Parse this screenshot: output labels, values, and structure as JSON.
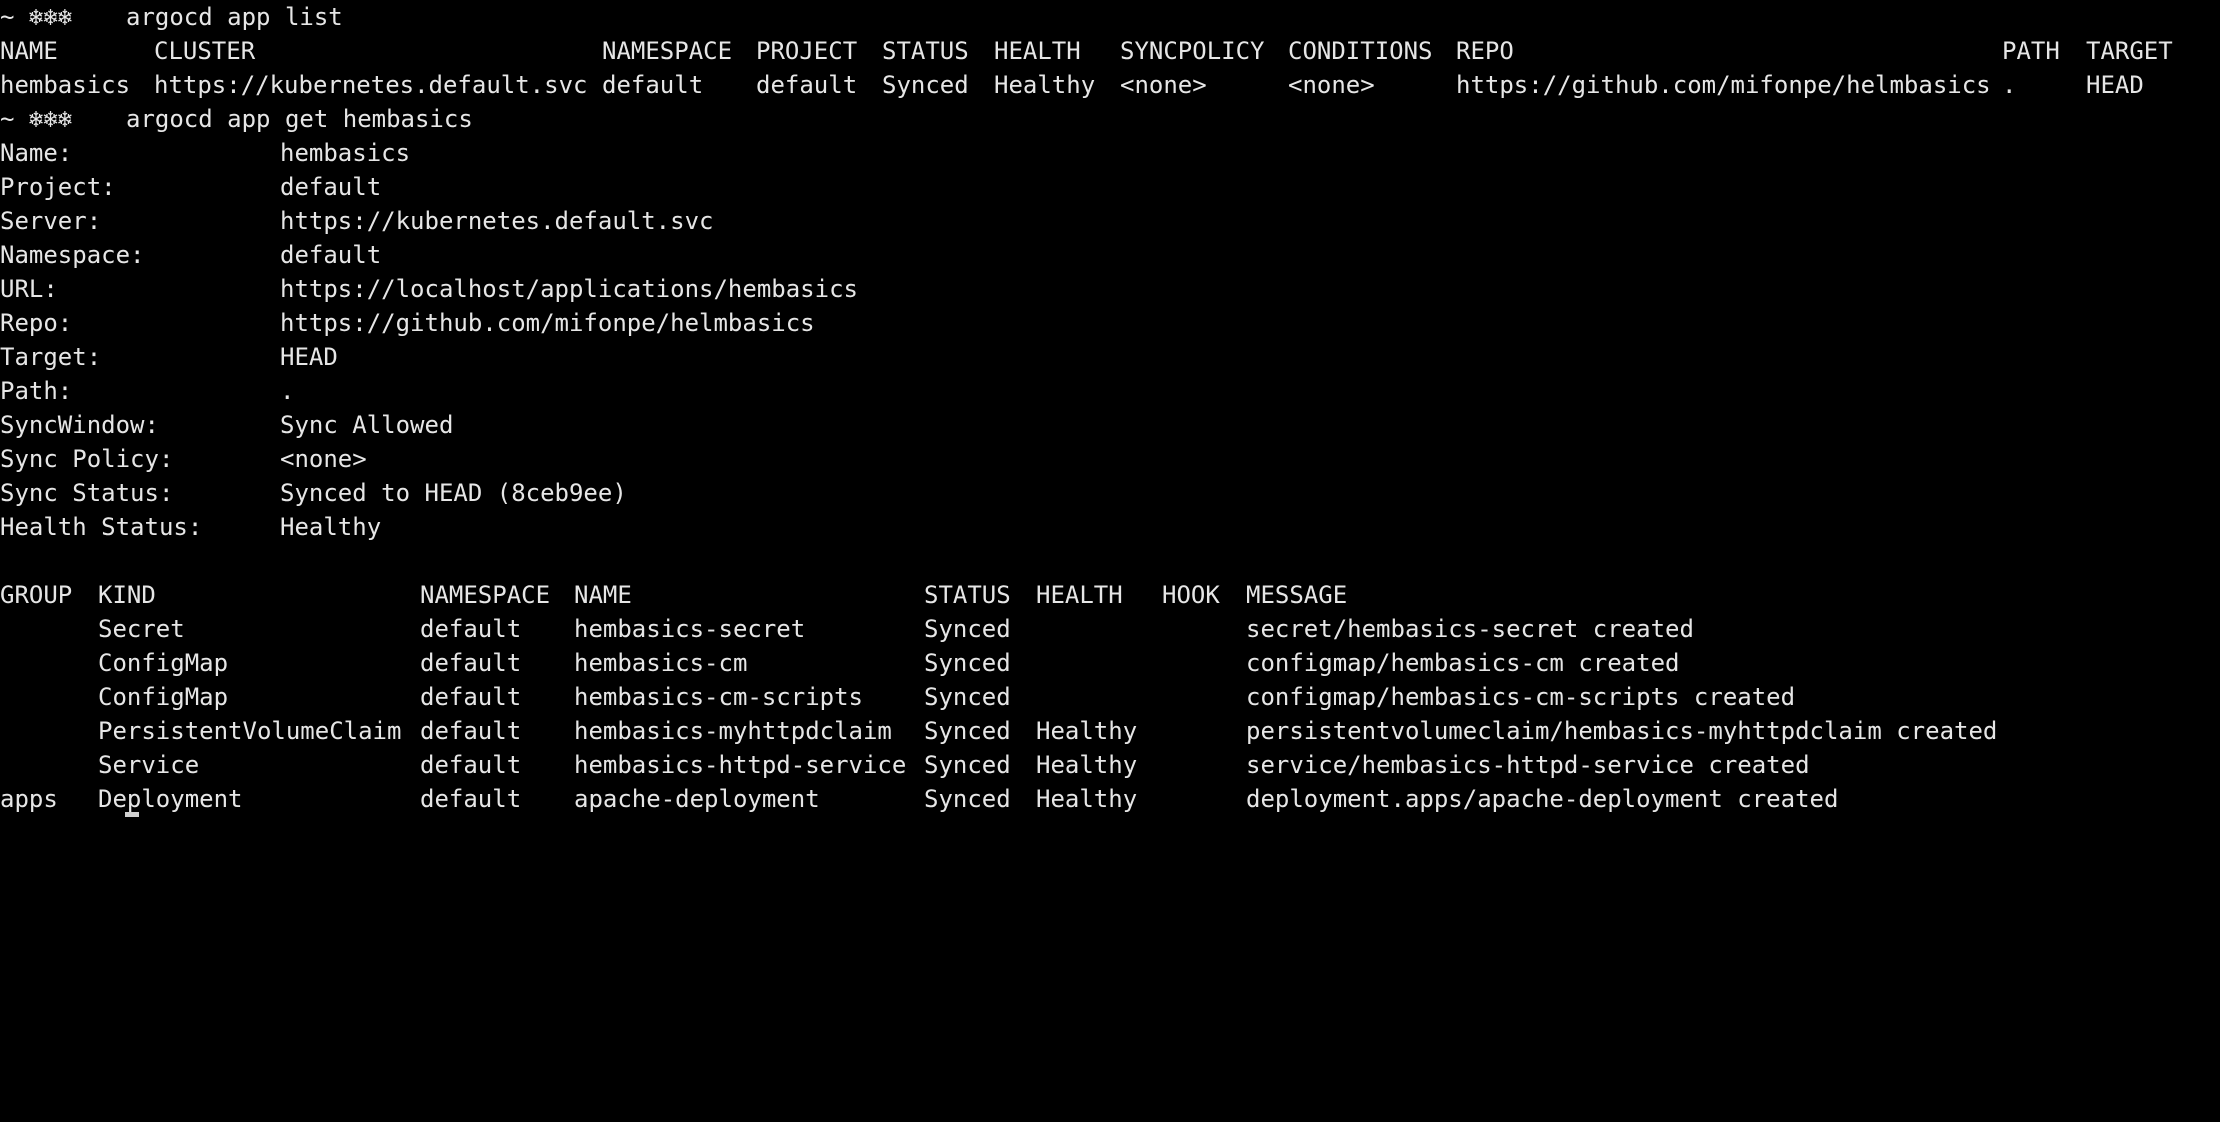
{
  "prompt": {
    "symbol": "~ ❄❄❄"
  },
  "commands": {
    "list": "argocd app list",
    "get": "argocd app get hembasics"
  },
  "app_list": {
    "headers": [
      "NAME",
      "CLUSTER",
      "NAMESPACE",
      "PROJECT",
      "STATUS",
      "HEALTH",
      "SYNCPOLICY",
      "CONDITIONS",
      "REPO",
      "PATH",
      "TARGET"
    ],
    "rows": [
      [
        "hembasics",
        "https://kubernetes.default.svc",
        "default",
        "default",
        "Synced",
        "Healthy",
        "<none>",
        "<none>",
        "https://github.com/mifonpe/helmbasics",
        ".",
        "HEAD"
      ]
    ]
  },
  "app_details": [
    {
      "label": "Name:",
      "value": "hembasics"
    },
    {
      "label": "Project:",
      "value": "default"
    },
    {
      "label": "Server:",
      "value": "https://kubernetes.default.svc"
    },
    {
      "label": "Namespace:",
      "value": "default"
    },
    {
      "label": "URL:",
      "value": "https://localhost/applications/hembasics"
    },
    {
      "label": "Repo:",
      "value": "https://github.com/mifonpe/helmbasics"
    },
    {
      "label": "Target:",
      "value": "HEAD"
    },
    {
      "label": "Path:",
      "value": "."
    },
    {
      "label": "SyncWindow:",
      "value": "Sync Allowed"
    },
    {
      "label": "Sync Policy:",
      "value": "<none>"
    },
    {
      "label": "Sync Status:",
      "value": "Synced to HEAD (8ceb9ee)"
    },
    {
      "label": "Health Status:",
      "value": "Healthy"
    }
  ],
  "resources": {
    "headers": [
      "GROUP",
      "KIND",
      "NAMESPACE",
      "NAME",
      "STATUS",
      "HEALTH",
      "HOOK",
      "MESSAGE"
    ],
    "rows": [
      [
        "",
        "Secret",
        "default",
        "hembasics-secret",
        "Synced",
        "",
        "",
        "secret/hembasics-secret created"
      ],
      [
        "",
        "ConfigMap",
        "default",
        "hembasics-cm",
        "Synced",
        "",
        "",
        "configmap/hembasics-cm created"
      ],
      [
        "",
        "ConfigMap",
        "default",
        "hembasics-cm-scripts",
        "Synced",
        "",
        "",
        "configmap/hembasics-cm-scripts created"
      ],
      [
        "",
        "PersistentVolumeClaim",
        "default",
        "hembasics-myhttpdclaim",
        "Synced",
        "Healthy",
        "",
        "persistentvolumeclaim/hembasics-myhttpdclaim created"
      ],
      [
        "",
        "Service",
        "default",
        "hembasics-httpd-service",
        "Synced",
        "Healthy",
        "",
        "service/hembasics-httpd-service created"
      ],
      [
        "apps",
        "Deployment",
        "default",
        "apache-deployment",
        "Synced",
        "Healthy",
        "",
        "deployment.apps/apache-deployment created"
      ]
    ]
  }
}
